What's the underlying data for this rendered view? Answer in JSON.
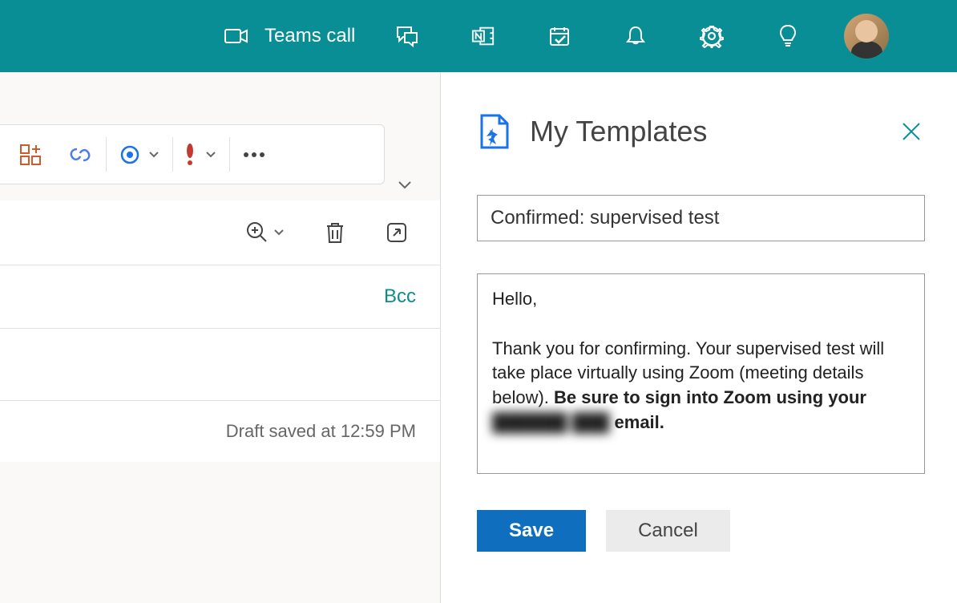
{
  "topbar": {
    "teams_call_label": "Teams call"
  },
  "compose": {
    "bcc_label": "Bcc",
    "draft_saved_label": "Draft saved at 12:59 PM"
  },
  "templates": {
    "panel_title": "My Templates",
    "name_value": "Confirmed: supervised test",
    "body_greeting": "Hello,",
    "body_p1": "Thank you for confirming. Your supervised test will take place virtually using Zoom (meeting details below). ",
    "body_bold": "Be sure to sign into Zoom using your ",
    "body_redacted": "██████ ███",
    "body_bold_tail": " email.",
    "save_label": "Save",
    "cancel_label": "Cancel"
  },
  "colors": {
    "teal": "#0a8e95",
    "primary_blue": "#106ebe"
  }
}
